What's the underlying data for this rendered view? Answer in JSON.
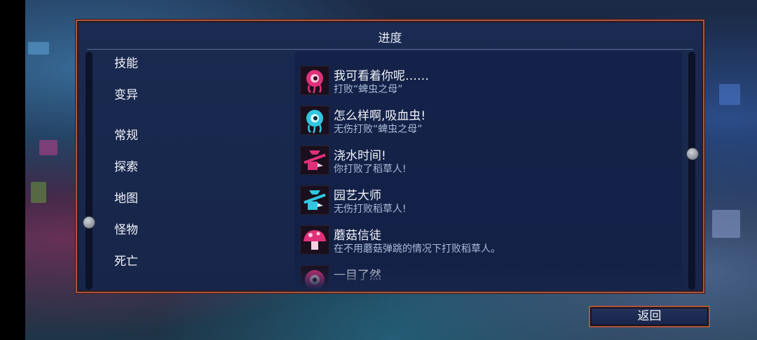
{
  "panel": {
    "title": "进度"
  },
  "categories": [
    "技能",
    "变异",
    "常规",
    "探索",
    "地图",
    "怪物",
    "死亡"
  ],
  "achievements": [
    {
      "title": "我可看着你呢……",
      "description": "打败“蜱虫之母”",
      "icon": "eyeball-icon",
      "color": "#e0307a"
    },
    {
      "title": "怎么样啊,吸血虫!",
      "description": "无伤打败“蜱虫之母”",
      "icon": "eyeball-icon",
      "color": "#2fc8e0"
    },
    {
      "title": "浇水时间!",
      "description": "你打败了稻草人!",
      "icon": "scarecrow-icon",
      "color": "#e0307a"
    },
    {
      "title": "园艺大师",
      "description": "无伤打败稻草人!",
      "icon": "scarecrow-icon",
      "color": "#2fc8e0"
    },
    {
      "title": "蘑菇信徒",
      "description": "在不用蘑菇弹跳的情况下打败稻草人。",
      "icon": "mushroom-icon",
      "color": "#e0307a"
    },
    {
      "title": "一目了然",
      "description": "",
      "icon": "eye-icon",
      "color": "#e0307a"
    }
  ],
  "back_button": {
    "label": "返回"
  }
}
